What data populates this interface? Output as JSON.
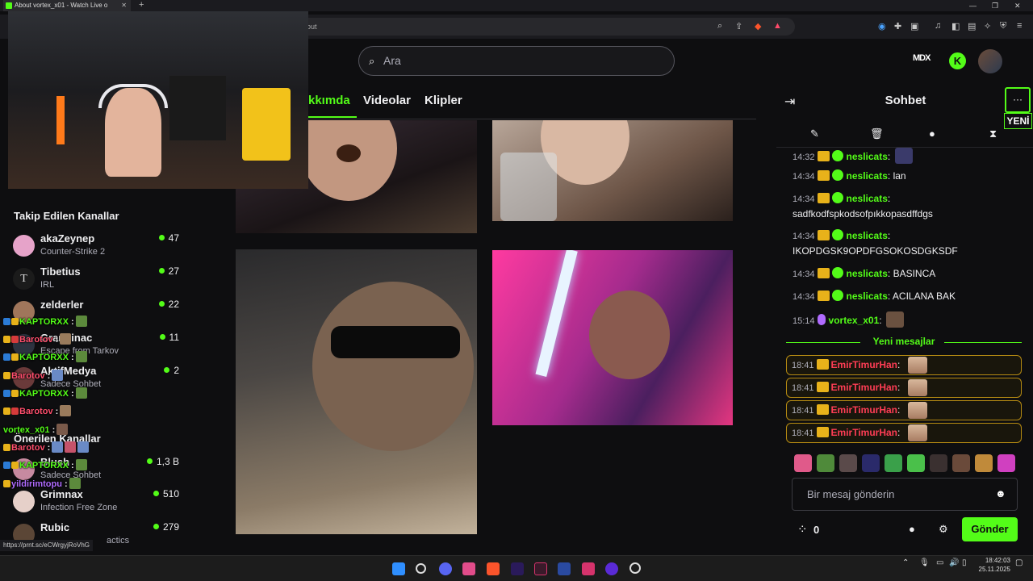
{
  "browser": {
    "tab_title": "About vortex_x01 - Watch Live o",
    "new_tab": "+",
    "url_fragment": "out",
    "status_url": "https://prnt.sc/eCWrgyjRoVhG"
  },
  "header": {
    "search_placeholder": "Ara",
    "brand_mark": "MDX",
    "logo_letter": "K"
  },
  "nav": {
    "tabs": [
      "kkımda",
      "Videolar",
      "Klipler"
    ],
    "active_tab": "kkımda"
  },
  "sidebar": {
    "followed_title": "Takip Edilen Kanallar",
    "followed": [
      {
        "name": "akaZeynep",
        "game": "Counter-Strike 2",
        "viewers": "47"
      },
      {
        "name": "Tibetius",
        "game": "IRL",
        "viewers": "27"
      },
      {
        "name": "zelderler",
        "game": "",
        "viewers": "22"
      },
      {
        "name": "Grandinac",
        "game": "Escape from Tarkov",
        "viewers": "11"
      },
      {
        "name": "AktifMedya",
        "game": "Sadece Sohbet",
        "viewers": "2"
      }
    ],
    "suggested_title": "Önerilen Kanallar",
    "suggested": [
      {
        "name": "Blush",
        "game": "Sadece Sohbet",
        "viewers": "1,3 B"
      },
      {
        "name": "Grimnax",
        "game": "Infection Free Zone",
        "viewers": "510"
      },
      {
        "name": "Rubic",
        "game": "actics",
        "viewers": "279"
      }
    ]
  },
  "overlay_chat": [
    {
      "user": "KAPTORXX",
      "suffix": ":",
      "color": "#53fc18"
    },
    {
      "user": "Barotov",
      "suffix": ":",
      "color": "#ff4f6d"
    },
    {
      "user": "KAPTORXX",
      "suffix": ":",
      "color": "#53fc18"
    },
    {
      "user": "Barotov",
      "suffix": ":",
      "color": "#ff4f6d"
    },
    {
      "user": "KAPTORXX",
      "suffix": ":",
      "color": "#53fc18"
    },
    {
      "user": "Barotov",
      "suffix": ":",
      "color": "#ff4f6d"
    },
    {
      "user": "vortex_x01",
      "suffix": ":",
      "color": "#53fc18"
    },
    {
      "user": "Barotov",
      "suffix": ":",
      "color": "#ff4f6d"
    },
    {
      "user": "KAPTORXX",
      "suffix": ":",
      "color": "#53fc18"
    },
    {
      "user": "yildirimtopu",
      "suffix": ":",
      "color": "#b06bff"
    }
  ],
  "chat": {
    "title": "Sohbet",
    "more": "···",
    "new_badge": "YENİ",
    "messages": [
      {
        "time": "14:32",
        "user": "neslicats",
        "text": ""
      },
      {
        "time": "14:34",
        "user": "neslicats",
        "text": "lan"
      },
      {
        "time": "14:34",
        "user": "neslicats",
        "text": "sadfkodfspkodsofpıkkopasdffdgs"
      },
      {
        "time": "14:34",
        "user": "neslicats",
        "text": "IKOPDGSK9OPDFGSOKOSDGKSDF"
      },
      {
        "time": "14:34",
        "user": "neslicats",
        "text": "BASINCA"
      },
      {
        "time": "14:34",
        "user": "neslicats",
        "text": "ACILANA BAK"
      },
      {
        "time": "15:14",
        "user": "vortex_x01",
        "text": ""
      }
    ],
    "new_messages_label": "Yeni mesajlar",
    "highlighted": [
      {
        "time": "18:41",
        "user": "EmirTimurHan"
      },
      {
        "time": "18:41",
        "user": "EmirTimurHan"
      },
      {
        "time": "18:41",
        "user": "EmirTimurHan"
      },
      {
        "time": "18:41",
        "user": "EmirTimurHan"
      }
    ],
    "input_placeholder": "Bir mesaj gönderin",
    "points": "0",
    "send_label": "Gönder"
  },
  "taskbar": {
    "time": "18:42:03",
    "date": "25.11.2025"
  },
  "colors": {
    "accent": "#53fc18",
    "background": "#0e0e10",
    "gold": "#e8b21a"
  }
}
